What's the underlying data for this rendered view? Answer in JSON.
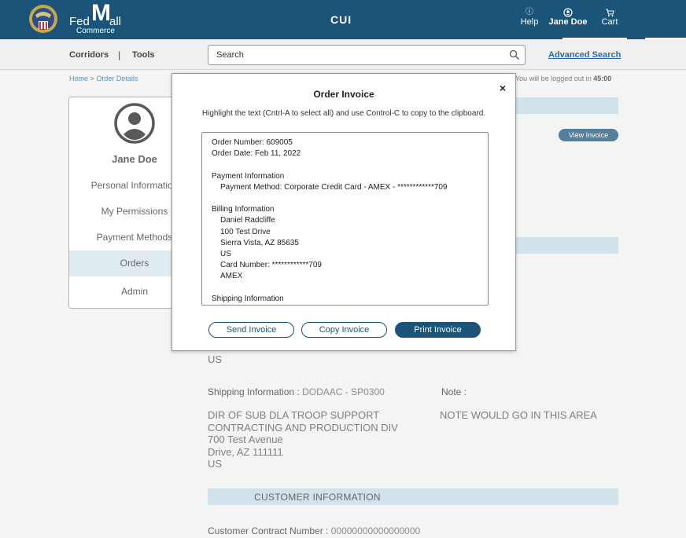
{
  "header": {
    "brand_fed": "Fed",
    "brand_m": "M",
    "brand_all": "all",
    "brand_sub": "Commerce",
    "classification": "CUI",
    "help_label": "Help",
    "user_label": "Jane Doe",
    "cart_label": "Cart"
  },
  "subnav": {
    "corridors": "Corridors",
    "separator": "|",
    "tools": "Tools",
    "search_value": "Search",
    "advanced_search": "Advanced Search"
  },
  "breadcrumb": {
    "home": "Home",
    "separator": ">",
    "current": "Order Details"
  },
  "session": {
    "logout_text": "You will be logged out in",
    "time": "45:00"
  },
  "sidebar": {
    "user_name": "Jane Doe",
    "items": [
      {
        "label": "Personal Information"
      },
      {
        "label": "My Permissions"
      },
      {
        "label": "Payment Methods"
      },
      {
        "label": "Orders",
        "active": true
      },
      {
        "label": "Admin"
      }
    ]
  },
  "main": {
    "view_invoice": "View Invoice",
    "billing_country": "US",
    "shipping_label": "Shipping Information :",
    "shipping_value": "DODAAC - SP0300",
    "note_label": "Note :",
    "address_lines": [
      "DIR OF SUB DLA TROOP SUPPORT",
      "CONTRACTING AND PRODUCTION DIV",
      "700 Test Avenue",
      "Drive, AZ 111111",
      "US"
    ],
    "note_text": "NOTE WOULD GO IN THIS AREA",
    "customer_info_title": "CUSTOMER INFORMATION",
    "contract_label": "Customer Contract Number :",
    "contract_value": "00000000000000000"
  },
  "modal": {
    "title": "Order Invoice",
    "close": "×",
    "instructions": "Highlight the text (Cntrl-A to select all) and use Control-C to copy to the clipboard.",
    "invoice": {
      "order_number": "Order Number: 609005",
      "order_date": "Order Date: Feb 11, 2022",
      "payment_heading": "Payment Information",
      "payment_method": "Payment Method: Corporate Credit Card - AMEX - ************709",
      "billing_heading": "Billing Information",
      "billing_name": "Daniel  Radcliffe",
      "billing_street": "100 Test Drive",
      "billing_city": "Sierra Vista, AZ 85635",
      "billing_country": "US",
      "card_number": "Card Number: ************709",
      "card_type": "AMEX",
      "shipping_heading": "Shipping Information"
    },
    "send_label": "Send Invoice",
    "copy_label": "Copy Invoice",
    "print_label": "Print Invoice"
  },
  "colors": {
    "header_bg": "#1a5478",
    "accent": "#2a6ca8",
    "section_bar": "#c2d9e5",
    "active_item": "#d7e5ee"
  }
}
